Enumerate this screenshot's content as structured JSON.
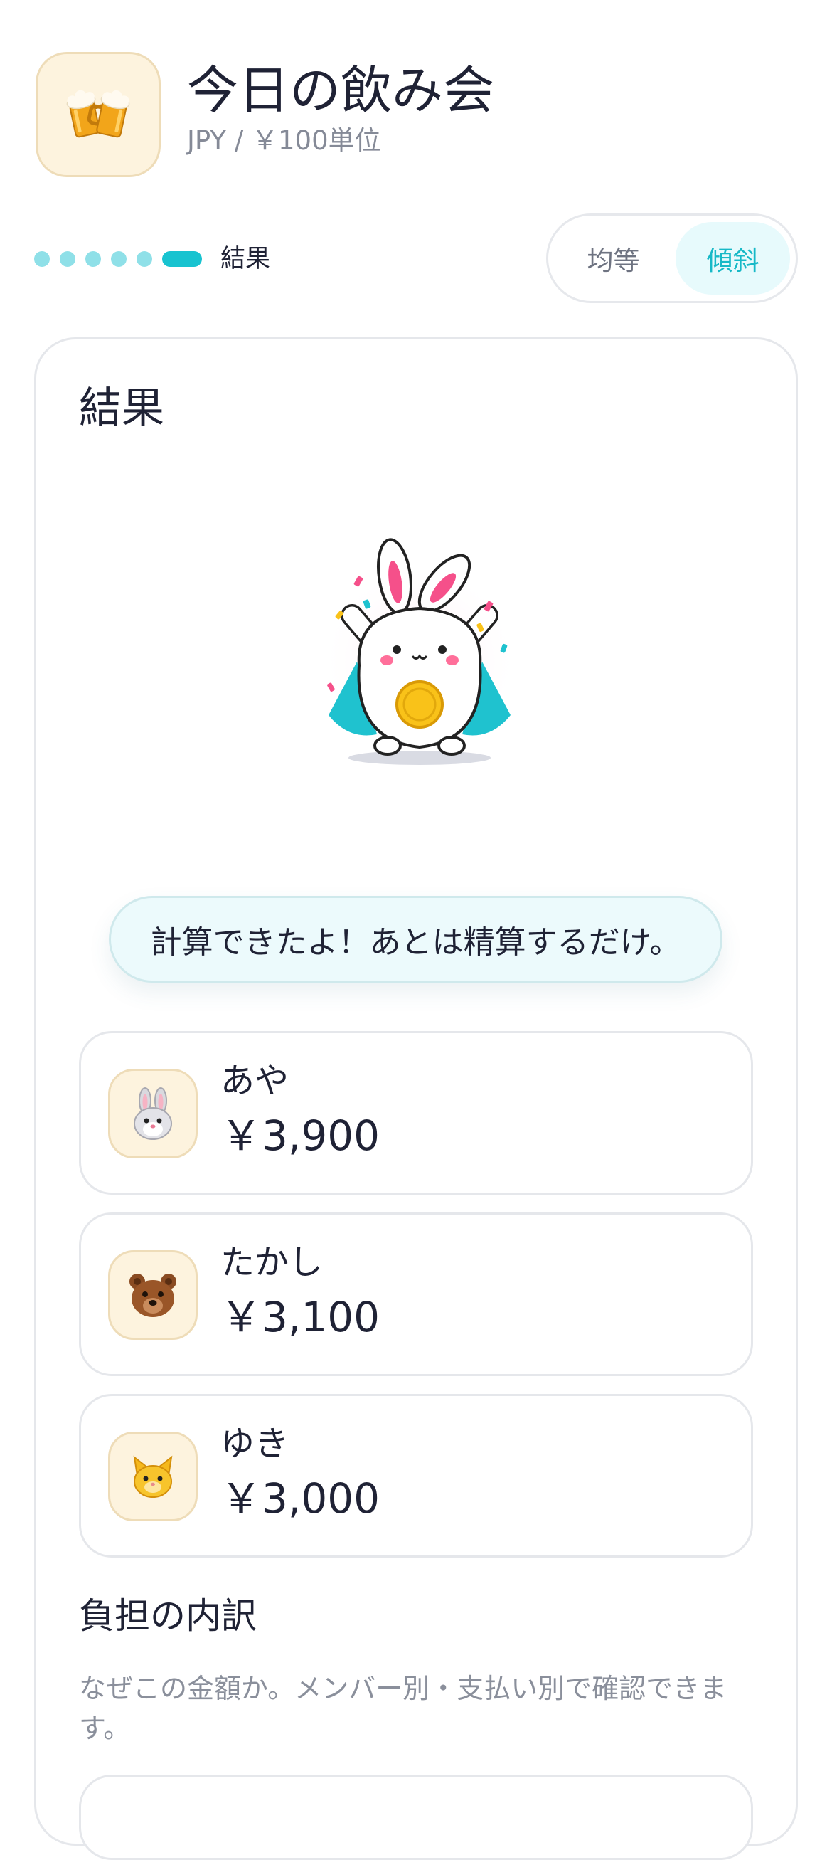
{
  "header": {
    "app_icon": "beer-mugs-icon",
    "title": "今日の飲み会",
    "subtitle": "JPY / ￥100単位"
  },
  "progress": {
    "total_steps": 6,
    "current_step": 6,
    "label": "結果"
  },
  "mode_toggle": {
    "options": [
      "均等",
      "傾斜"
    ],
    "selected": "傾斜"
  },
  "result": {
    "title": "結果",
    "mascot": "rabbit-mascot-with-coin-illustration",
    "message": "計算できたよ！あとは精算するだけ。",
    "people": [
      {
        "name": "あや",
        "amount": "￥3,900",
        "avatar": "rabbit-icon"
      },
      {
        "name": "たかし",
        "amount": "￥3,100",
        "avatar": "bear-icon"
      },
      {
        "name": "ゆき",
        "amount": "￥3,000",
        "avatar": "cat-icon"
      }
    ]
  },
  "breakdown": {
    "title": "負担の内訳",
    "description": "なぜこの金額か。メンバー別・支払い別で確認できます。"
  },
  "colors": {
    "accent": "#18c3d0",
    "accent_light": "#8fe0e8",
    "avatar_bg": "#fdf3de",
    "bubble_bg": "#ecfafc"
  }
}
